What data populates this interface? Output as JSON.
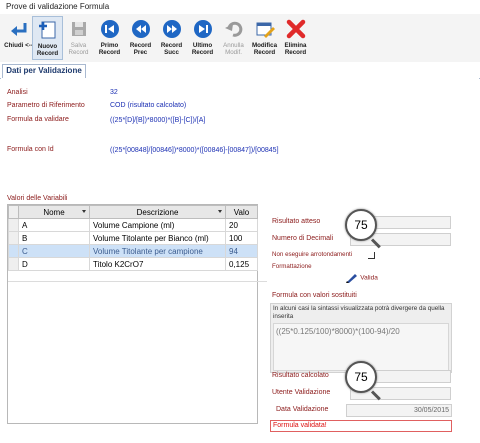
{
  "window": {
    "title": "Prove di validazione Formula"
  },
  "toolbar": {
    "buttons": [
      {
        "label": "Chiudi <--",
        "icon": "back-arrow-icon",
        "enabled": true
      },
      {
        "label": "Nuovo Record",
        "icon": "new-record-icon",
        "enabled": true,
        "active": true
      },
      {
        "label": "Salva Record",
        "icon": "save-icon",
        "enabled": false
      },
      {
        "label": "Primo Record",
        "icon": "first-record-icon",
        "enabled": true
      },
      {
        "label": "Record Prec",
        "icon": "previous-record-icon",
        "enabled": true
      },
      {
        "label": "Record Succ",
        "icon": "next-record-icon",
        "enabled": true
      },
      {
        "label": "Ultimo Record",
        "icon": "last-record-icon",
        "enabled": true
      },
      {
        "label": "Annulla Modif.",
        "icon": "undo-icon",
        "enabled": false
      },
      {
        "label": "Modifica Record",
        "icon": "edit-record-icon",
        "enabled": true
      },
      {
        "label": "Elimina Record",
        "icon": "delete-icon",
        "enabled": true
      }
    ]
  },
  "tab": {
    "label": "Dati per Validazione"
  },
  "fields": {
    "analisi_label": "Analisi",
    "analisi_value": "32",
    "parametro_label": "Parametro di Riferimento",
    "parametro_value": "COD (risultato calcolato)",
    "formula_label": "Formula da validare",
    "formula_value": "((25*[D]/[B])*8000)*([B]-[C])/[A]",
    "formula_id_label": "Formula con Id",
    "formula_id_value": "((25*[00848]/[00846])*8000)*([00846]-[00847])/[00845]"
  },
  "variables": {
    "title": "Valori delle Variabili",
    "columns": [
      "Nome",
      "Descrizione",
      "Valo"
    ],
    "rows": [
      {
        "nome": "A",
        "descrizione": "Volume Campione (ml)",
        "valore": "20"
      },
      {
        "nome": "B",
        "descrizione": "Volume Titolante per Bianco (ml)",
        "valore": "100"
      },
      {
        "nome": "C",
        "descrizione": "Volume Titolante per campione",
        "valore": "94"
      },
      {
        "nome": "D",
        "descrizione": "Titolo K2CrO7",
        "valore": "0,125"
      }
    ],
    "selected_row": 2
  },
  "right_panel": {
    "risultato_atteso_label": "Risultato atteso",
    "risultato_atteso_value": "75",
    "numero_decimali_label": "Numero di Decimali",
    "non_eseguire_label": "Non eseguire arrotondamenti",
    "formattazione_label": "Formattazione",
    "valida_label": "Valida",
    "formula_valori_title": "Formula con valori sostituiti",
    "formula_note": "In alcuni casi la sintassi visualizzata potrà divergere da quella inserita",
    "formula_valori_value": "((25*0.125/100)*8000)*(100-94)/20",
    "risultato_calcolato_label": "Risultato calcolato",
    "risultato_calcolato_value": "75",
    "utente_validazione_label": "Utente Validazione",
    "data_validazione_label": "Data Validazione",
    "data_validazione_value": "30/05/2015",
    "status_message": "Formula validata!"
  }
}
